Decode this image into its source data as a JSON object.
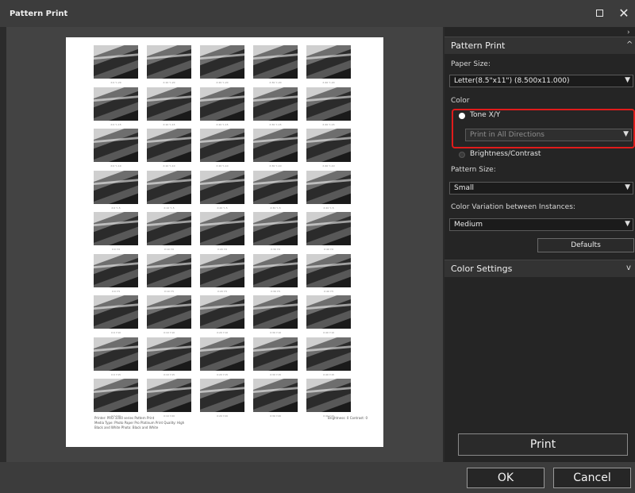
{
  "window": {
    "title": "Pattern Print"
  },
  "preview": {
    "rows": 9,
    "cols": 5,
    "captions": [
      [
        "X:0 Y:-20",
        "X:10 Y:-20",
        "X:20 Y:-20",
        "X:30 Y:-20",
        "X:40 Y:-20"
      ],
      [
        "X:0 Y:-15",
        "X:10 Y:-15",
        "X:20 Y:-15",
        "X:30 Y:-15",
        "X:40 Y:-15"
      ],
      [
        "X:0 Y:-10",
        "X:10 Y:-10",
        "X:20 Y:-10",
        "X:30 Y:-10",
        "X:40 Y:-10"
      ],
      [
        "X:0 Y:-5",
        "X:10 Y:-5",
        "X:20 Y:-5",
        "X:30 Y:-5",
        "X:40 Y:-5"
      ],
      [
        "X:0 Y:0",
        "X:10 Y:0",
        "X:20 Y:0",
        "X:30 Y:0",
        "X:40 Y:0"
      ],
      [
        "X:0 Y:5",
        "X:10 Y:5",
        "X:20 Y:5",
        "X:30 Y:5",
        "X:40 Y:5"
      ],
      [
        "X:0 Y:10",
        "X:10 Y:10",
        "X:20 Y:10",
        "X:30 Y:10",
        "X:40 Y:10"
      ],
      [
        "X:0 Y:15",
        "X:10 Y:15",
        "X:20 Y:15",
        "X:30 Y:15",
        "X:40 Y:15"
      ],
      [
        "X:0 Y:20",
        "X:10 Y:20",
        "X:20 Y:20",
        "X:30 Y:20",
        "X:40 Y:20"
      ]
    ],
    "note_left": "Printer: PRO-1000 series  Pattern Print\nMedia Type: Photo Paper Pro Platinum   Print Quality: High\nBlack and White Photo: Black and White",
    "note_right": "Brightness: 0  Contrast: 0"
  },
  "panel": {
    "section_pattern_print": "Pattern Print",
    "paper_size_label": "Paper Size:",
    "paper_size_value": "Letter(8.5\"x11\") (8.500x11.000)",
    "color_label": "Color",
    "tone_xy_label": "Tone X/Y",
    "tone_direction_value": "Print in All Directions",
    "brightness_contrast_label": "Brightness/Contrast",
    "pattern_size_label": "Pattern Size:",
    "pattern_size_value": "Small",
    "variation_label": "Color Variation between Instances:",
    "variation_value": "Medium",
    "defaults_label": "Defaults",
    "section_color_settings": "Color Settings",
    "print_label": "Print"
  },
  "footer": {
    "ok_label": "OK",
    "cancel_label": "Cancel"
  },
  "colors": {
    "highlight": "#e11b1b",
    "panel_bg": "#252525",
    "window_bg": "#3c3c3c"
  }
}
